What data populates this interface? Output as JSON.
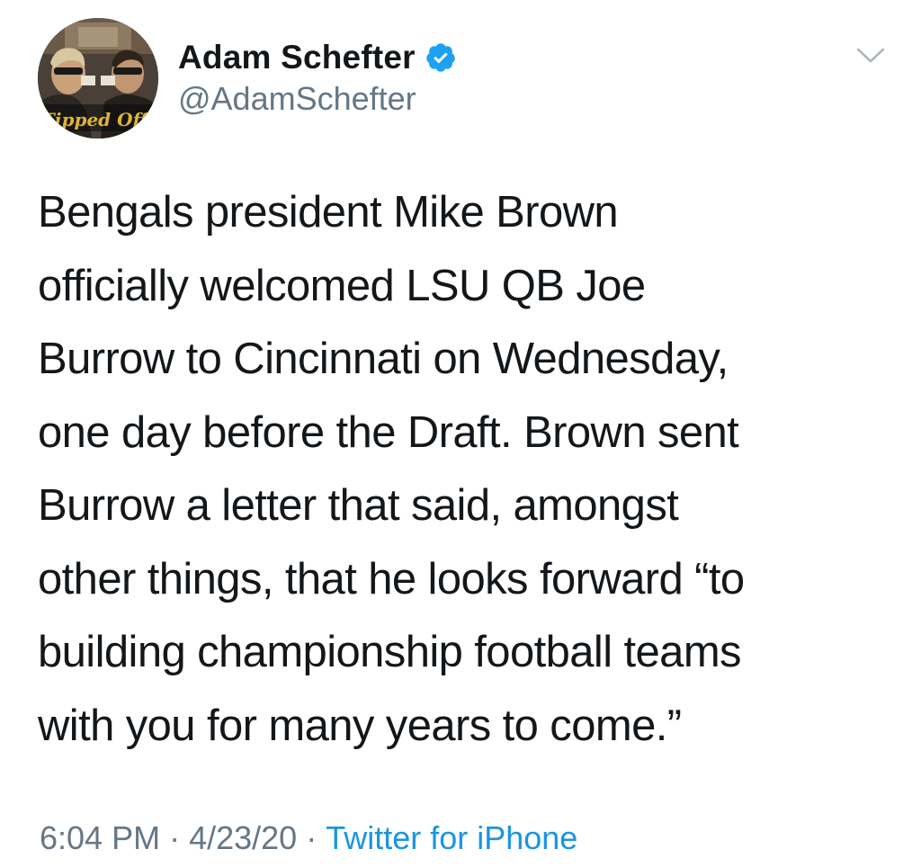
{
  "author": {
    "display_name": "Adam Schefter",
    "handle": "@AdamSchefter",
    "verified": true,
    "avatar_caption": "Tipped Off"
  },
  "menu": {
    "icon": "chevron-down-icon"
  },
  "tweet": {
    "text": "Bengals president Mike Brown\nofficially welcomed LSU QB Joe\nBurrow to Cincinnati on Wednesday,\none day before the Draft. Brown sent\nBurrow a letter that said, amongst\nother things, that he looks forward “to\nbuilding championship football teams\nwith you for many years to come.”"
  },
  "meta": {
    "time": "6:04 PM",
    "separator": "·",
    "date": "4/23/20",
    "source": "Twitter for iPhone"
  },
  "colors": {
    "text": "#14171a",
    "secondary": "#657786",
    "link": "#1b95e0",
    "verified": "#1da1f2"
  }
}
